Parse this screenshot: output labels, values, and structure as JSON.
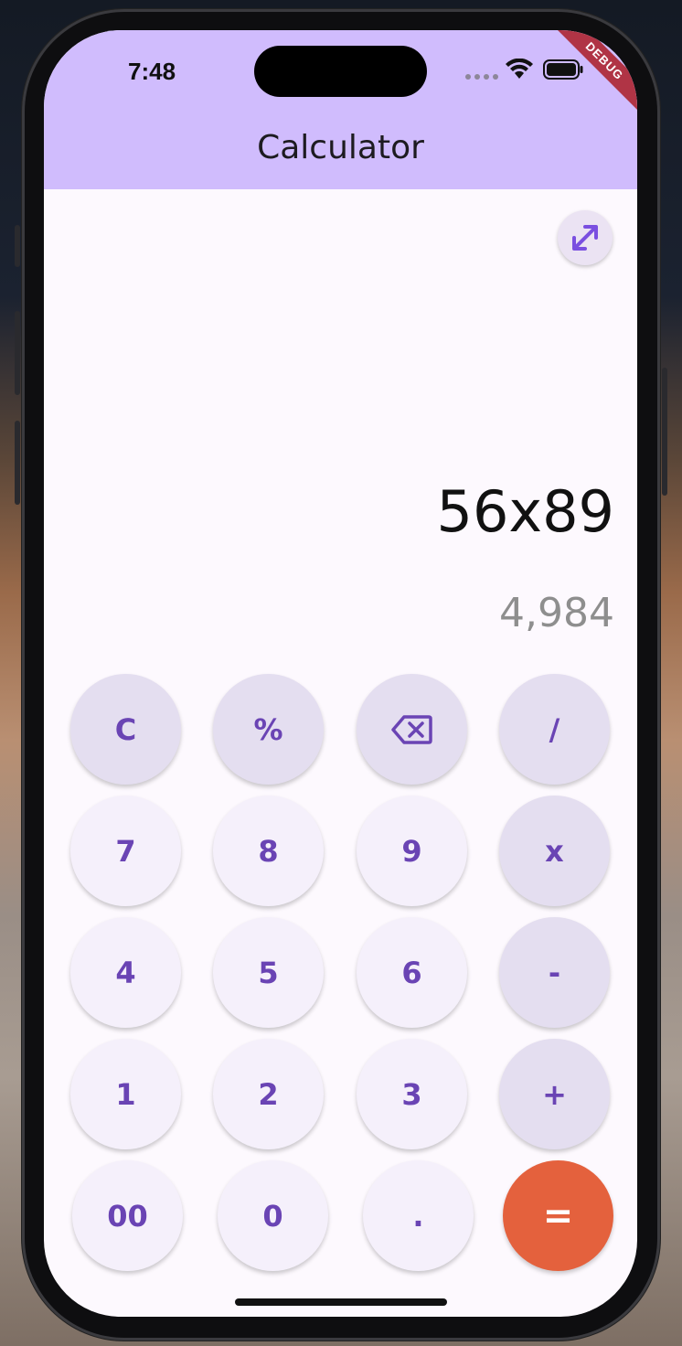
{
  "status_bar": {
    "time": "7:48",
    "debug_label": "DEBUG"
  },
  "app_bar": {
    "title": "Calculator"
  },
  "display": {
    "expression": "56x89",
    "result": "4,984"
  },
  "keypad": {
    "row1": [
      "C",
      "%",
      "⌫",
      "/"
    ],
    "row2": [
      "7",
      "8",
      "9",
      "x"
    ],
    "row3": [
      "4",
      "5",
      "6",
      "-"
    ],
    "row4": [
      "1",
      "2",
      "3",
      "+"
    ],
    "row5": [
      "00",
      "0",
      ".",
      "="
    ]
  },
  "colors": {
    "app_bar": "#d0bcfd",
    "background": "#fdf9fe",
    "key_text": "#6a44b4",
    "operator_key": "#e4def0",
    "digit_key": "#f5f0fb",
    "equals_key": "#e4613d",
    "result_text": "#8e8e8e"
  },
  "icons": {
    "expand": "expand-diagonal-icon",
    "backspace": "backspace-icon"
  }
}
